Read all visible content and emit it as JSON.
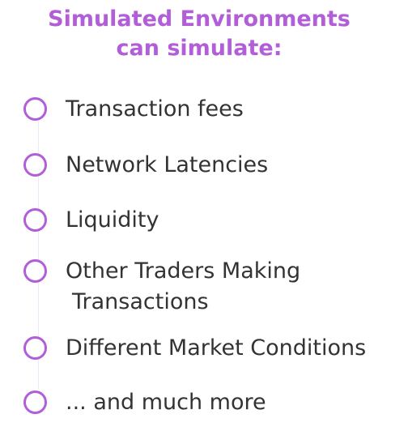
{
  "title": {
    "line1": "Simulated Environments",
    "line2": "can simulate:"
  },
  "items": [
    {
      "lines": [
        "Transaction fees"
      ]
    },
    {
      "lines": [
        "Network Latencies"
      ]
    },
    {
      "lines": [
        "Liquidity"
      ]
    },
    {
      "lines": [
        "Other Traders Making",
        "Transactions"
      ]
    },
    {
      "lines": [
        "Different Market Conditions"
      ]
    },
    {
      "lines": [
        "... and much more"
      ]
    }
  ],
  "colors": {
    "accent": "#b25ed8",
    "text": "#333333",
    "line": "#f1e8f6",
    "background": "#ffffff"
  },
  "icons": {
    "bullet": "circle-outline-icon"
  }
}
